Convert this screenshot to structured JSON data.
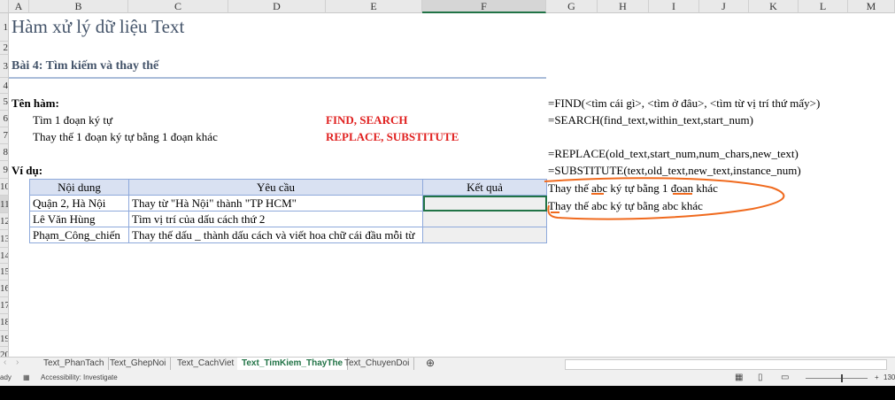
{
  "columns": [
    "A",
    "B",
    "C",
    "D",
    "E",
    "F",
    "G",
    "H",
    "I",
    "J",
    "K",
    "L",
    "M"
  ],
  "rows": [
    "1",
    "2",
    "3",
    "4",
    "5",
    "6",
    "7",
    "8",
    "9",
    "10",
    "11",
    "12",
    "13",
    "14",
    "15",
    "16",
    "17",
    "18",
    "19",
    "20"
  ],
  "title": "Hàm xử lý dữ liệu Text",
  "subtitle": "Bài 4: Tìm kiếm và thay thế",
  "func_label": "Tên hàm:",
  "items": [
    {
      "desc": "Tìm 1 đoạn ký tự",
      "funcs": "FIND, SEARCH"
    },
    {
      "desc": "Thay thế 1 đoạn ký tự bằng 1 đoạn khác",
      "funcs": "REPLACE, SUBSTITUTE"
    }
  ],
  "example_label": "Ví dụ:",
  "table": {
    "headers": [
      "Nội dung",
      "Yêu cầu",
      "Kết quả"
    ],
    "rows": [
      [
        "Quận 2, Hà Nội",
        "Thay từ \"Hà Nội\" thành \"TP HCM\"",
        ""
      ],
      [
        "Lê Văn Hùng",
        "Tìm vị trí của dấu cách thứ 2",
        ""
      ],
      [
        "Phạm_Công_chiến",
        "Thay thế dấu _ thành dấu cách và viết hoa chữ cái đầu mỗi từ",
        ""
      ]
    ]
  },
  "syntax": [
    "=FIND(<tìm cái gì>, <tìm ở đâu>, <tìm từ vị trí thứ mấy>)",
    "=SEARCH(find_text,within_text,start_num)",
    "=REPLACE(old_text,start_num,num_chars,new_text)",
    "=SUBSTITUTE(text,old_text,new_text,instance_num)"
  ],
  "notes": [
    "Thay thế abc ký tự bằng 1 đoạn khác",
    "Thay thế abc ký tự bằng abc khác"
  ],
  "annotation_color": "#f06a1e",
  "sheet_tabs": [
    "Text_PhanTach",
    "Text_GhepNoi",
    "Text_CachViet",
    "Text_TimKiem_ThayThe",
    "Text_ChuyenDoi"
  ],
  "status": {
    "ready": "ady",
    "accessibility": "Accessibility: Investigate",
    "zoom": "130"
  }
}
